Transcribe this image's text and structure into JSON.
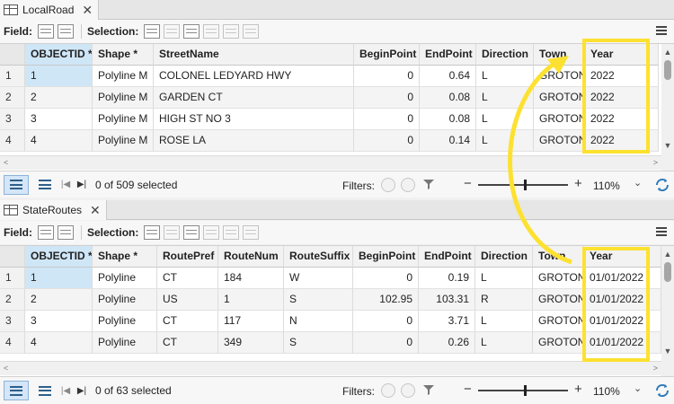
{
  "panel1": {
    "tab": {
      "title": "LocalRoad",
      "close_glyph": "✕"
    },
    "toolbar": {
      "field_label": "Field:",
      "selection_label": "Selection:"
    },
    "columns": [
      "OBJECTID *",
      "Shape *",
      "StreetName",
      "BeginPoint",
      "EndPoint",
      "Direction",
      "Town",
      "Year"
    ],
    "rows": [
      {
        "num": "1",
        "cells": [
          "1",
          "Polyline M",
          "COLONEL LEDYARD HWY",
          "0",
          "0.64",
          "L",
          "GROTON",
          "2022"
        ]
      },
      {
        "num": "2",
        "cells": [
          "2",
          "Polyline M",
          "GARDEN CT",
          "0",
          "0.08",
          "L",
          "GROTON",
          "2022"
        ]
      },
      {
        "num": "3",
        "cells": [
          "3",
          "Polyline M",
          "HIGH ST NO 3",
          "0",
          "0.08",
          "L",
          "GROTON",
          "2022"
        ]
      },
      {
        "num": "4",
        "cells": [
          "4",
          "Polyline M",
          "ROSE LA",
          "0",
          "0.14",
          "L",
          "GROTON",
          "2022"
        ]
      }
    ],
    "footer": {
      "selected": "0 of 509 selected",
      "filters_label": "Filters:",
      "zoom": "110%"
    }
  },
  "panel2": {
    "tab": {
      "title": "StateRoutes",
      "close_glyph": "✕"
    },
    "toolbar": {
      "field_label": "Field:",
      "selection_label": "Selection:"
    },
    "columns": [
      "OBJECTID *",
      "Shape *",
      "RoutePref",
      "RouteNum",
      "RouteSuffix",
      "BeginPoint",
      "EndPoint",
      "Direction",
      "Town",
      "Year"
    ],
    "rows": [
      {
        "num": "1",
        "cells": [
          "1",
          "Polyline",
          "CT",
          "184",
          "W",
          "0",
          "0.19",
          "L",
          "GROTON",
          "01/01/2022"
        ]
      },
      {
        "num": "2",
        "cells": [
          "2",
          "Polyline",
          "US",
          "1",
          "S",
          "102.95",
          "103.31",
          "R",
          "GROTON",
          "01/01/2022"
        ]
      },
      {
        "num": "3",
        "cells": [
          "3",
          "Polyline",
          "CT",
          "117",
          "N",
          "0",
          "3.71",
          "L",
          "GROTON",
          "01/01/2022"
        ]
      },
      {
        "num": "4",
        "cells": [
          "4",
          "Polyline",
          "CT",
          "349",
          "S",
          "0",
          "0.26",
          "L",
          "GROTON",
          "01/01/2022"
        ]
      }
    ],
    "footer": {
      "selected": "0 of 63 selected",
      "filters_label": "Filters:",
      "zoom": "110%"
    }
  },
  "icons": {
    "tab": "table-icon",
    "close": "close-icon",
    "menu": "menu-icon",
    "nav_first": "first-record-icon",
    "nav_last": "last-record-icon",
    "refresh": "refresh-icon",
    "filter": "filter-icon",
    "minus_glyph": "−",
    "plus_glyph": "+",
    "caret_glyph": "⌄",
    "nav_first_glyph": "|◀",
    "nav_last_glyph": "▶|",
    "scroll_up": "▲",
    "scroll_down": "▼"
  },
  "colors": {
    "highlight": "#fde130",
    "selected_cell": "#cfe6f7",
    "accent": "#2e79b9"
  }
}
